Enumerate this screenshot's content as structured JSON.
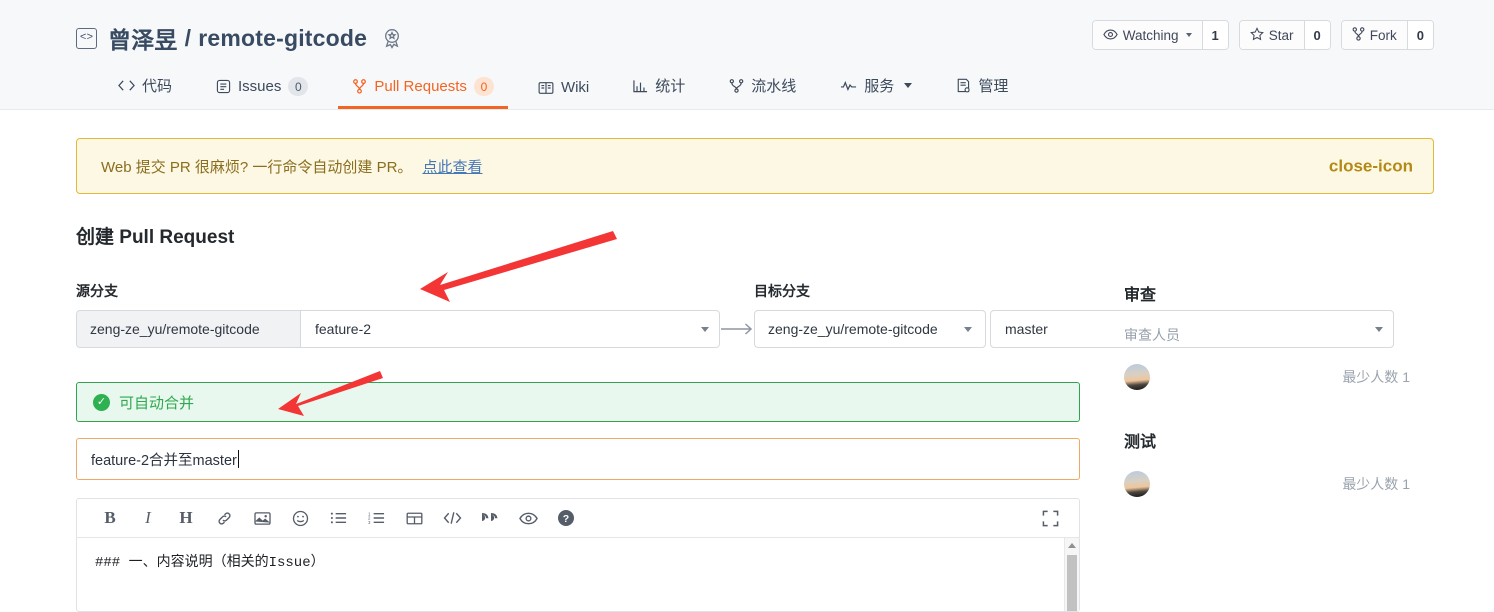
{
  "header": {
    "repo_icon": "code-brackets-icon",
    "owner": "曾泽昱",
    "separator": "/",
    "repo": "remote-gitcode",
    "badge_icon": "award-badge-icon",
    "actions": [
      {
        "icon": "eye-icon",
        "label": "Watching",
        "count": "1",
        "has_caret": true
      },
      {
        "icon": "star-icon",
        "label": "Star",
        "count": "0",
        "has_caret": false
      },
      {
        "icon": "fork-icon",
        "label": "Fork",
        "count": "0",
        "has_caret": false
      }
    ],
    "tabs": [
      {
        "icon": "code-icon",
        "label": "代码",
        "badge": null,
        "active": false,
        "caret": false
      },
      {
        "icon": "issues-icon",
        "label": "Issues",
        "badge": "0",
        "active": false,
        "caret": false
      },
      {
        "icon": "pull-request-icon",
        "label": "Pull Requests",
        "badge": "0",
        "active": true,
        "caret": false
      },
      {
        "icon": "wiki-icon",
        "label": "Wiki",
        "badge": null,
        "active": false,
        "caret": false
      },
      {
        "icon": "chart-icon",
        "label": "统计",
        "badge": null,
        "active": false,
        "caret": false
      },
      {
        "icon": "pipeline-icon",
        "label": "流水线",
        "badge": null,
        "active": false,
        "caret": false
      },
      {
        "icon": "service-icon",
        "label": "服务",
        "badge": null,
        "active": false,
        "caret": true
      },
      {
        "icon": "manage-icon",
        "label": "管理",
        "badge": null,
        "active": false,
        "caret": false
      }
    ]
  },
  "notice": {
    "text": "Web 提交 PR 很麻烦? 一行命令自动创建 PR。",
    "link": "点此查看",
    "close_icon": "close-icon"
  },
  "page_title": "创建 Pull Request",
  "source_branch": {
    "label": "源分支",
    "repo": "zeng-ze_yu/remote-gitcode",
    "branch": "feature-2"
  },
  "arrow_icon": "arrow-right-icon",
  "target_branch": {
    "label": "目标分支",
    "repo": "zeng-ze_yu/remote-gitcode",
    "branch": "master"
  },
  "merge_status": {
    "icon": "check-circle-icon",
    "text": "可自动合并"
  },
  "pr_title_input": {
    "value": "feature-2合并至master"
  },
  "editor": {
    "toolbar": [
      {
        "name": "bold-icon",
        "glyph": "B"
      },
      {
        "name": "italic-icon",
        "glyph": "I"
      },
      {
        "name": "heading-icon",
        "glyph": "H"
      },
      {
        "name": "link-icon",
        "glyph": "link"
      },
      {
        "name": "image-icon",
        "glyph": "image"
      },
      {
        "name": "emoji-icon",
        "glyph": "emoji"
      },
      {
        "name": "bullet-list-icon",
        "glyph": "ul"
      },
      {
        "name": "numbered-list-icon",
        "glyph": "ol"
      },
      {
        "name": "table-icon",
        "glyph": "table"
      },
      {
        "name": "code-icon",
        "glyph": "code"
      },
      {
        "name": "quote-icon",
        "glyph": "quote"
      },
      {
        "name": "preview-eye-icon",
        "glyph": "eye"
      },
      {
        "name": "help-icon",
        "glyph": "help"
      }
    ],
    "fullscreen_icon": "fullscreen-icon",
    "body_text": "### 一、内容说明（相关的Issue）"
  },
  "sidebar": {
    "review_heading": "审查",
    "reviewer_label": "审查人员",
    "reviewer_min": "最少人数 1",
    "test_heading": "测试",
    "tester_min": "最少人数 1",
    "avatar_icon": "user-avatar"
  },
  "colors": {
    "accent_orange": "#f26522",
    "notice_bg": "#fdf8e3",
    "notice_border": "#e3b93a",
    "success_green": "#2fa84f",
    "success_bg": "#e9f8ee",
    "annotation_red": "#f43535"
  },
  "annotations": [
    {
      "name": "arrow-to-source-branch"
    },
    {
      "name": "arrow-to-title-input"
    }
  ]
}
